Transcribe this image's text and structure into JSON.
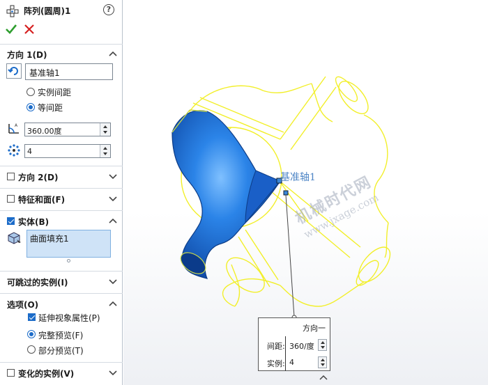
{
  "panel": {
    "title": "阵列(圆周)1",
    "help_icon": "question-circle-icon",
    "ok_icon": "check-icon",
    "cancel_icon": "x-icon",
    "direction1": {
      "label": "方向 1(D)",
      "axis_value": "基准轴1",
      "option_instance_spacing": "实例间距",
      "option_equal_spacing": "等间距",
      "angle_value": "360.00度",
      "count_value": "4"
    },
    "direction2": {
      "label": "方向 2(D)"
    },
    "features_faces": {
      "label": "特征和面(F)"
    },
    "bodies": {
      "label": "实体(B)",
      "item": "曲面填充1"
    },
    "skippable": {
      "label": "可跳过的实例(I)"
    },
    "options": {
      "label": "选项(O)",
      "propagate_visual": "延伸视象属性(P)",
      "full_preview": "完整预览(F)",
      "partial_preview": "部分预览(T)"
    },
    "varied": {
      "label": "变化的实例(V)"
    }
  },
  "viewport": {
    "axis_label": "基准轴1",
    "watermark_line1": "机械时代网",
    "watermark_line2": "www.jxage.com",
    "callout": {
      "title": "方向一",
      "spacing_label": "间距:",
      "spacing_value": "360/度",
      "count_label": "实例:",
      "count_value": "4"
    }
  },
  "colors": {
    "preview_yellow": "#f2ef2a",
    "body_blue": "#1f6fd6",
    "accent": "#1c6cc9"
  }
}
